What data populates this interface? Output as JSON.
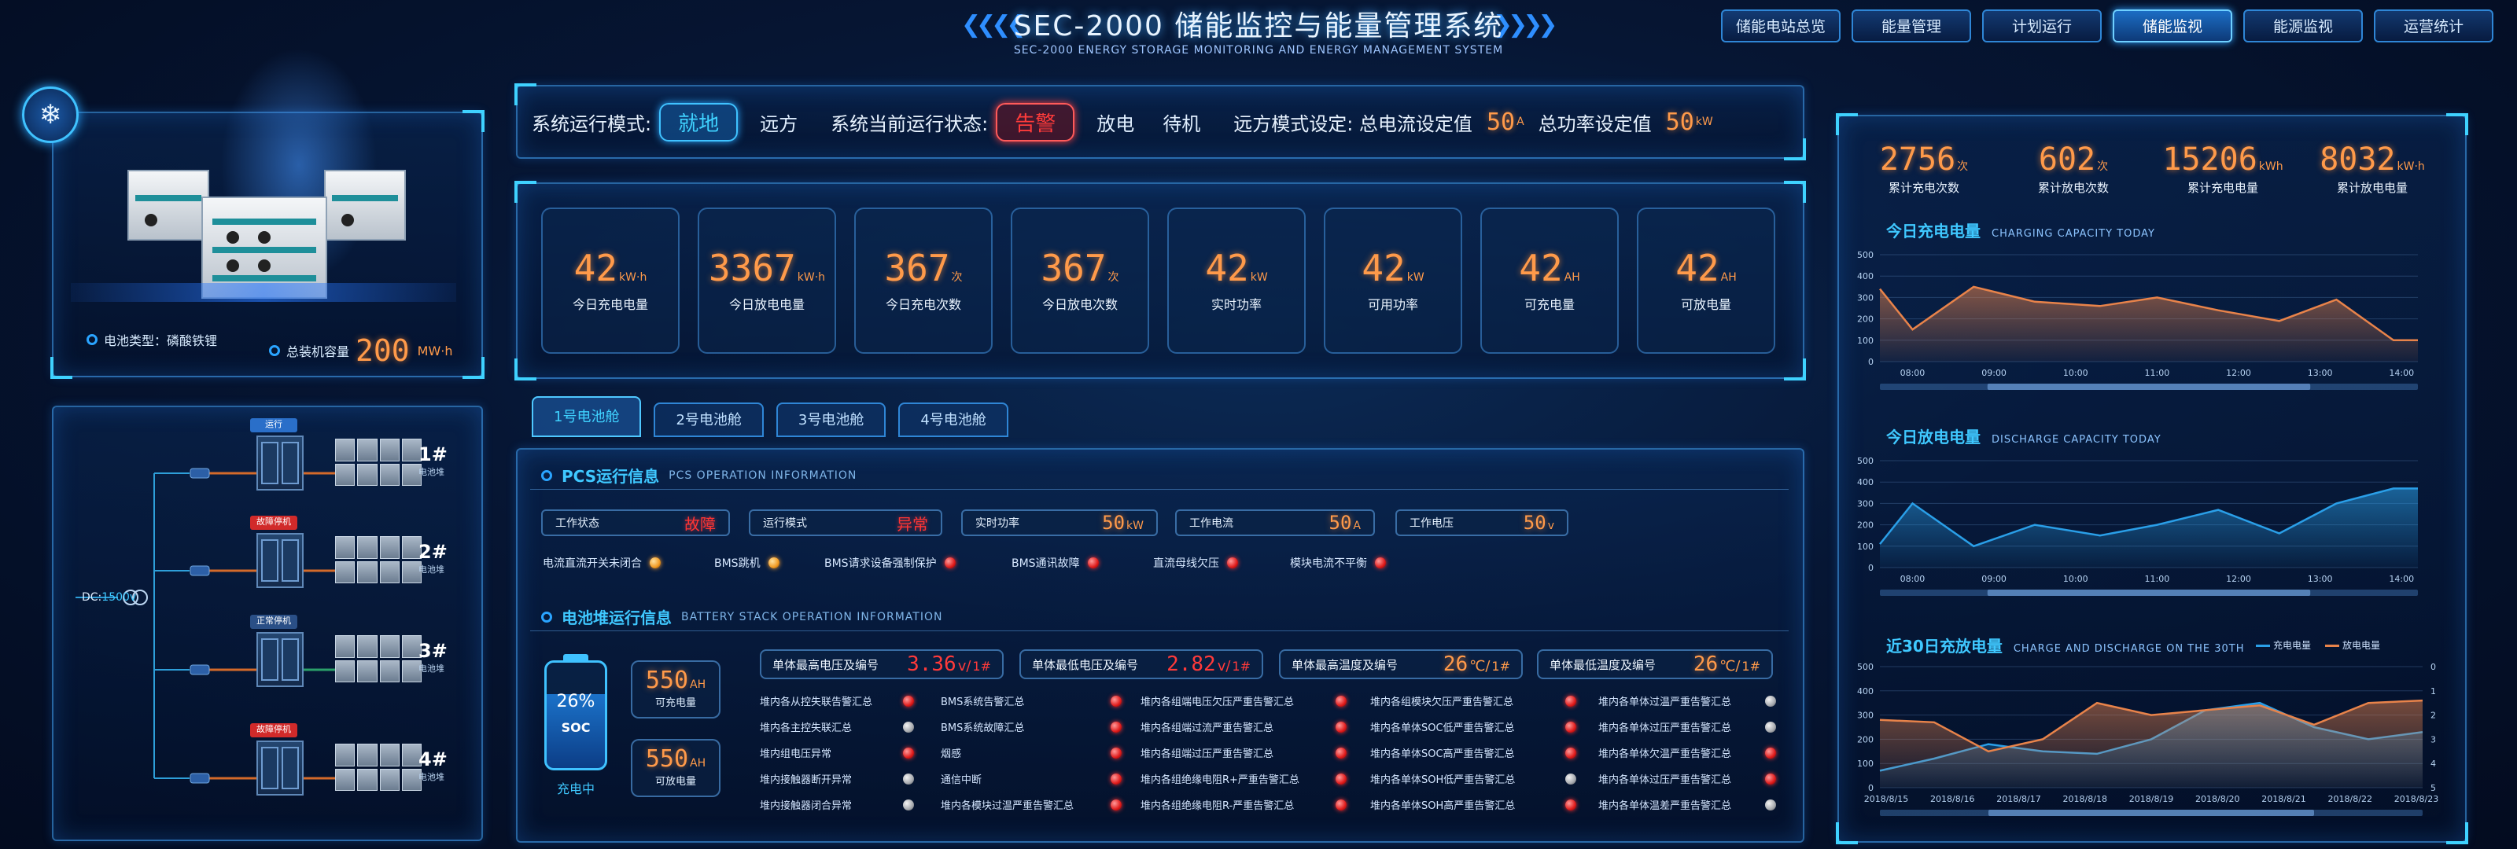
{
  "header": {
    "title": "SEC-2000 储能监控与能量管理系统",
    "subtitle": "SEC-2000  ENERGY STORAGE MONITORING AND ENERGY MANAGEMENT SYSTEM",
    "nav": [
      {
        "label": "储能电站总览",
        "active": false
      },
      {
        "label": "能量管理",
        "active": false
      },
      {
        "label": "计划运行",
        "active": false
      },
      {
        "label": "储能监视",
        "active": true
      },
      {
        "label": "能源监视",
        "active": false
      },
      {
        "label": "运营统计",
        "active": false
      }
    ]
  },
  "left": {
    "battery_type_label": "电池类型：磷酸铁锂",
    "capacity_label": "总装机容量",
    "capacity_value": "200",
    "capacity_unit": "MW·h",
    "dc_label": "DC:",
    "dc_value": "1500v",
    "units": [
      {
        "label": "1#",
        "sub": "电池堆",
        "status": "运行",
        "status_color": "#2a6fc9"
      },
      {
        "label": "2#",
        "sub": "电池堆",
        "status": "故障停机",
        "status_color": "#d12a2a"
      },
      {
        "label": "3#",
        "sub": "电池堆",
        "status": "正常停机",
        "status_color": "#2a4f86"
      },
      {
        "label": "4#",
        "sub": "电池堆",
        "status": "故障停机",
        "status_color": "#d12a2a"
      }
    ]
  },
  "mode_bar": {
    "mode_label": "系统运行模式:",
    "mode_active": "就地",
    "mode_other": "远方",
    "state_label": "系统当前运行状态:",
    "state_active": "告警",
    "state_1": "放电",
    "state_2": "待机",
    "remote_label": "远方模式设定: 总电流设定值",
    "current_value": "50",
    "current_unit": "A",
    "power_label": "总功率设定值",
    "power_value": "50",
    "power_unit": "kW"
  },
  "stats": [
    {
      "value": "42",
      "unit": "kW·h",
      "label": "今日充电电量"
    },
    {
      "value": "3367",
      "unit": "kW·h",
      "label": "今日放电电量"
    },
    {
      "value": "367",
      "unit": "次",
      "label": "今日充电次数"
    },
    {
      "value": "367",
      "unit": "次",
      "label": "今日放电次数"
    },
    {
      "value": "42",
      "unit": "kW",
      "label": "实时功率"
    },
    {
      "value": "42",
      "unit": "kW",
      "label": "可用功率"
    },
    {
      "value": "42",
      "unit": "AH",
      "label": "可充电量"
    },
    {
      "value": "42",
      "unit": "AH",
      "label": "可放电量"
    }
  ],
  "tabs": [
    "1号电池舱",
    "2号电池舱",
    "3号电池舱",
    "4号电池舱"
  ],
  "pcs": {
    "title": "PCS运行信息",
    "title_en": "PCS OPERATION INFORMATION",
    "boxes": [
      {
        "label": "工作状态",
        "value": "故障",
        "unit": "",
        "red": true
      },
      {
        "label": "运行模式",
        "value": "异常",
        "unit": "",
        "red": true
      },
      {
        "label": "实时功率",
        "value": "50",
        "unit": "kW",
        "red": false
      },
      {
        "label": "工作电流",
        "value": "50",
        "unit": "A",
        "red": false
      },
      {
        "label": "工作电压",
        "value": "50",
        "unit": "v",
        "red": false
      }
    ],
    "alarms": [
      {
        "label": "电流直流开关未闭合",
        "led": "orange"
      },
      {
        "label": "BMS跳机",
        "led": "orange"
      },
      {
        "label": "BMS请求设备强制保护",
        "led": "red"
      },
      {
        "label": "BMS通讯故障",
        "led": "red"
      },
      {
        "label": "直流母线欠压",
        "led": "red"
      },
      {
        "label": "模块电流不平衡",
        "led": "red"
      }
    ]
  },
  "stack": {
    "title": "电池堆运行信息",
    "title_en": "BATTERY STACK OPERATION INFORMATION",
    "soc_value": "26%",
    "soc_fill": 0.7,
    "soc_label": "SOC",
    "soc_status": "充电中",
    "charge_cap": {
      "value": "550",
      "unit": "AH",
      "label": "可充电量"
    },
    "discharge_cap": {
      "value": "550",
      "unit": "AH",
      "label": "可放电量"
    },
    "cells": [
      {
        "label": "单体最高电压及编号",
        "value": "3.36",
        "unit": "v/",
        "idx": "1#",
        "red": true
      },
      {
        "label": "单体最低电压及编号",
        "value": "2.82",
        "unit": "v/",
        "idx": "1#",
        "red": true
      },
      {
        "label": "单体最高温度及编号",
        "value": "26",
        "unit": "℃/",
        "idx": "1#",
        "red": false
      },
      {
        "label": "单体最低温度及编号",
        "value": "26",
        "unit": "℃/",
        "idx": "1#",
        "red": false
      }
    ],
    "alarm_cols": [
      [
        {
          "label": "堆内各从控失联告警汇总",
          "led": "red"
        },
        {
          "label": "堆内各主控失联汇总",
          "led": "gray"
        },
        {
          "label": "堆内组电压异常",
          "led": "red"
        },
        {
          "label": "堆内接触器断开异常",
          "led": "gray"
        },
        {
          "label": "堆内接触器闭合异常",
          "led": "gray"
        }
      ],
      [
        {
          "label": "BMS系统告警汇总",
          "led": "red"
        },
        {
          "label": "BMS系统故障汇总",
          "led": "red"
        },
        {
          "label": "烟感",
          "led": "red"
        },
        {
          "label": "通信中断",
          "led": "red"
        },
        {
          "label": "堆内各模块过温严重告警汇总",
          "led": "red"
        }
      ],
      [
        {
          "label": "堆内各组端电压欠压严重告警汇总",
          "led": "red"
        },
        {
          "label": "堆内各组端过流严重告警汇总",
          "led": "red"
        },
        {
          "label": "堆内各组端过压严重告警汇总",
          "led": "red"
        },
        {
          "label": "堆内各组绝缘电阻R+严重告警汇总",
          "led": "red"
        },
        {
          "label": "堆内各组绝缘电阻R-严重告警汇总",
          "led": "red"
        }
      ],
      [
        {
          "label": "堆内各组模块欠压严重告警汇总",
          "led": "red"
        },
        {
          "label": "堆内各单体SOC低严重告警汇总",
          "led": "red"
        },
        {
          "label": "堆内各单体SOC高严重告警汇总",
          "led": "red"
        },
        {
          "label": "堆内各单体SOH低严重告警汇总",
          "led": "gray"
        },
        {
          "label": "堆内各单体SOH高严重告警汇总",
          "led": "red"
        }
      ],
      [
        {
          "label": "堆内各单体过温严重告警汇总",
          "led": "gray"
        },
        {
          "label": "堆内各单体过压严重告警汇总",
          "led": "gray"
        },
        {
          "label": "堆内各单体欠温严重告警汇总",
          "led": "red"
        },
        {
          "label": "堆内各单体过压严重告警汇总",
          "led": "red"
        },
        {
          "label": "堆内各单体温差严重告警汇总",
          "led": "gray"
        }
      ]
    ]
  },
  "right_stats": [
    {
      "value": "2756",
      "unit": "次",
      "label": "累计充电次数"
    },
    {
      "value": "602",
      "unit": "次",
      "label": "累计放电次数"
    },
    {
      "value": "15206",
      "unit": "kWh",
      "label": "累计充电电量"
    },
    {
      "value": "8032",
      "unit": "kW·h",
      "label": "累计放电电量"
    }
  ],
  "chart_data": [
    {
      "type": "area",
      "title": "今日充电电量",
      "title_en": "CHARGING CAPACITY TODAY",
      "x": [
        "08:00",
        "09:00",
        "10:00",
        "11:00",
        "12:00",
        "13:00",
        "14:00"
      ],
      "x_points": [
        7.6,
        8.0,
        8.75,
        9.5,
        10.3,
        11.0,
        11.75,
        12.5,
        13.2,
        13.9,
        14.2
      ],
      "values": [
        340,
        150,
        350,
        280,
        260,
        300,
        240,
        190,
        290,
        100,
        100
      ],
      "ylim": [
        0,
        500
      ],
      "yticks": [
        0,
        100,
        200,
        300,
        400,
        500
      ],
      "color": "#e8834a"
    },
    {
      "type": "area",
      "title": "今日放电电量",
      "title_en": "DISCHARGE CAPACITY TODAY",
      "x": [
        "08:00",
        "09:00",
        "10:00",
        "11:00",
        "12:00",
        "13:00",
        "14:00"
      ],
      "x_points": [
        7.6,
        8.0,
        8.75,
        9.5,
        10.3,
        11.0,
        11.75,
        12.5,
        13.2,
        13.9,
        14.2
      ],
      "values": [
        110,
        300,
        100,
        200,
        150,
        200,
        270,
        160,
        300,
        370,
        370
      ],
      "ylim": [
        0,
        500
      ],
      "yticks": [
        0,
        100,
        200,
        300,
        400,
        500
      ],
      "color": "#2a9fe8"
    },
    {
      "type": "area",
      "title": "近30日充放电量",
      "title_en": "CHARGE AND DISCHARGE ON THE 30TH",
      "legend": [
        "充电电量",
        "放电电量"
      ],
      "x": [
        "2018/8/15",
        "2018/8/16",
        "2018/8/17",
        "2018/8/18",
        "2018/8/19",
        "2018/8/20",
        "2018/8/21",
        "2018/8/22",
        "2018/8/23"
      ],
      "ylim": [
        0,
        500
      ],
      "yticks": [
        0,
        100,
        200,
        300,
        400,
        500
      ],
      "y2ticks": [
        0,
        1,
        2,
        3,
        4,
        5
      ],
      "series": [
        {
          "name": "充电电量",
          "color": "#2a9fe8",
          "values": [
            70,
            120,
            180,
            150,
            140,
            200,
            320,
            350,
            250,
            200,
            230
          ]
        },
        {
          "name": "放电电量",
          "color": "#e8834a",
          "values": [
            280,
            270,
            150,
            200,
            350,
            300,
            320,
            340,
            260,
            350,
            360
          ]
        }
      ]
    }
  ]
}
